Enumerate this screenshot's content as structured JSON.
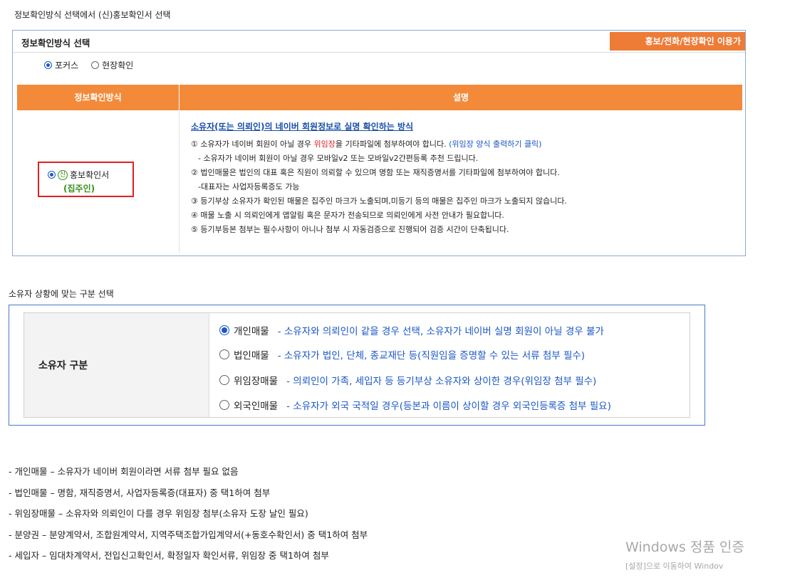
{
  "section1_heading": "정보확인방식 선택에서 (신)홍보확인서 선택",
  "method_box": {
    "title": "정보확인방식 선택",
    "orange_tab": "홍보/전화/현장확인 이용가",
    "radios": [
      {
        "label": "포커스",
        "selected": true
      },
      {
        "label": "현장확인",
        "selected": false
      }
    ],
    "table": {
      "col1": "정보확인방식",
      "col2": "설명",
      "selected_option": {
        "badge": "신",
        "label": "홍보확인서",
        "sub": "(집주인)"
      },
      "desc_title": "소유자(또는 의뢰인)의 네이버 회원정보로 실명 확인하는 방식",
      "lines": {
        "l1_a": "① 소유자가 네이버 회원이 아닐 경우 ",
        "l1_red": "위임장",
        "l1_b": "을 기타파일에 첨부하여야 합니다. ",
        "l1_blue": "(위임장 양식 출력하기 클릭)",
        "l2": "- 소유자가 네이버 회원이 아닐 경우 모바일v2 또는 모바일v2간편등록 추천 드립니다.",
        "l3": "② 법인매물은 법인의 대표 혹은 직원이 의뢰할 수 있으며 명함 또는 재직증명서를 기타파일에 첨부하여야 합니다.",
        "l4": "-대표자는 사업자등록증도 가능",
        "l5": "③ 등기부상 소유자가 확인된 매물은 집주인 마크가 노출되며,미등기 등의 매물은 집주인 마크가 노출되지 않습니다.",
        "l6": "④ 매물 노출 시 의뢰인에게 앱알림 혹은 문자가 전송되므로 의뢰인에게 사전 안내가 필요합니다.",
        "l7": "⑤ 등기부등본 첨부는 필수사항이 아니나 첨부 시 자동검증으로 진행되어 검증 시간이 단축됩니다."
      }
    }
  },
  "section2_heading": "소유자 상황에 맞는 구분 선택",
  "owner_box": {
    "label": "소유자 구분",
    "options": [
      {
        "name": "개인매물",
        "desc": "- 소유자와 의뢰인이 같을 경우 선택, 소유자가 네이버 실명 회원이 아닐 경우 불가",
        "selected": true
      },
      {
        "name": "법인매물",
        "desc": "- 소유자가 법인, 단체, 종교재단 등(직원임을 증명할 수 있는 서류 첨부 필수)",
        "selected": false
      },
      {
        "name": "위임장매물",
        "desc": "- 의뢰인이 가족, 세입자 등 등기부상 소유자와 상이한 경우(위임장 첨부 필수)",
        "selected": false
      },
      {
        "name": "외국인매물",
        "desc": "- 소유자가 외국 국적일 경우(등본과 이름이 상이할 경우 외국인등록증 첨부 필요)",
        "selected": false
      }
    ]
  },
  "notes": [
    "- 개인매물 – 소유자가 네이버 회원이라면 서류 첨부 필요 없음",
    "- 법인매물 – 명함, 재직증명서, 사업자등록증(대표자) 중 택1하여 첨부",
    "- 위임장매물 – 소유자와 의뢰인이 다를 경우 위임장 첨부(소유자 도장 날인 필요)",
    "- 분양권 – 분양계약서, 조합원계약서, 지역주택조합가입계약서(+동호수확인서) 중 택1하여 첨부",
    "- 세입자 – 임대차계약서, 전입신고확인서, 확정일자 확인서류, 위임장 중 택1하여 첨부"
  ],
  "watermark": {
    "line1": "Windows 정품 인증",
    "line2": "[설정]으로 이동하여 Windov"
  },
  "colors": {
    "orange": "#f28a3a",
    "blue_text": "#1a56c6",
    "red": "#e02020",
    "green": "#3a8f1e"
  }
}
